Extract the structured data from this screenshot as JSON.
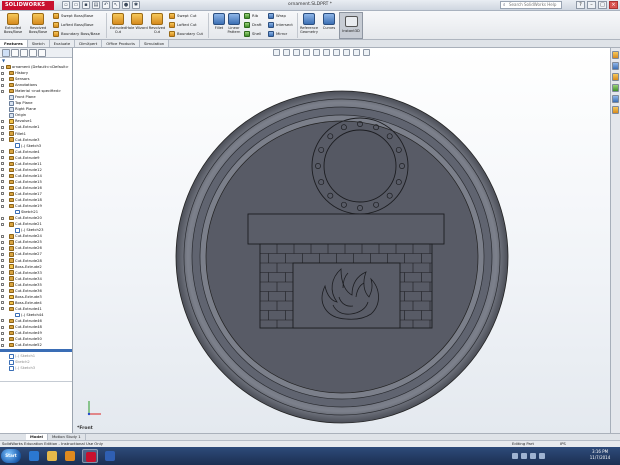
{
  "app": {
    "logo": "SOLIDWORKS",
    "document_title": "ornament.SLDPRT *",
    "search_placeholder": "Search SolidWorks Help"
  },
  "ribbon": {
    "extruded_boss": "Extruded Boss/Base",
    "revolved_boss": "Revolved Boss/Base",
    "swept_boss": "Swept Boss/Base",
    "lofted_boss": "Lofted Boss/Base",
    "boundary_boss": "Boundary Boss/Base",
    "extruded_cut": "Extruded Cut",
    "hole_wizard": "Hole Wizard",
    "revolved_cut": "Revolved Cut",
    "swept_cut": "Swept Cut",
    "lofted_cut": "Lofted Cut",
    "boundary_cut": "Boundary Cut",
    "fillet": "Fillet",
    "linear_pattern": "Linear Pattern",
    "rib": "Rib",
    "draft": "Draft",
    "shell": "Shell",
    "wrap": "Wrap",
    "intersect": "Intersect",
    "mirror": "Mirror",
    "reference_geometry": "Reference Geometry",
    "curves": "Curves",
    "instant3d": "Instant3D"
  },
  "tabs": [
    "Features",
    "Sketch",
    "Evaluate",
    "DimXpert",
    "Office Products",
    "Simulation"
  ],
  "feature_tree": {
    "filter_icon": "funnel-icon",
    "items": [
      {
        "label": "ornament  (Default<<Default>",
        "indent": 1,
        "kind": "part"
      },
      {
        "label": "History",
        "indent": 2,
        "kind": "folder"
      },
      {
        "label": "Sensors",
        "indent": 2,
        "kind": "folder"
      },
      {
        "label": "Annotations",
        "indent": 2,
        "kind": "folder"
      },
      {
        "label": "Material <not specified>",
        "indent": 2,
        "kind": "folder"
      },
      {
        "label": "Front Plane",
        "indent": 2,
        "kind": "plane"
      },
      {
        "label": "Top Plane",
        "indent": 2,
        "kind": "plane"
      },
      {
        "label": "Right Plane",
        "indent": 2,
        "kind": "plane"
      },
      {
        "label": "Origin",
        "indent": 2,
        "kind": "plane"
      },
      {
        "label": "Revolve1",
        "indent": 2,
        "kind": "boss"
      },
      {
        "label": "Cut-Extrude1",
        "indent": 2,
        "kind": "cut"
      },
      {
        "label": "Fillet1",
        "indent": 2,
        "kind": "cut"
      },
      {
        "label": "Cut-Extrude3",
        "indent": 2,
        "kind": "cut"
      },
      {
        "label": "(-) Sketch3",
        "indent": 4,
        "kind": "sketch"
      },
      {
        "label": "Cut-Extrude4",
        "indent": 2,
        "kind": "cut"
      },
      {
        "label": "Cut-Extrude9",
        "indent": 2,
        "kind": "cut"
      },
      {
        "label": "Cut-Extrude11",
        "indent": 2,
        "kind": "cut"
      },
      {
        "label": "Cut-Extrude12",
        "indent": 2,
        "kind": "cut"
      },
      {
        "label": "Cut-Extrude14",
        "indent": 2,
        "kind": "cut"
      },
      {
        "label": "Cut-Extrude15",
        "indent": 2,
        "kind": "cut"
      },
      {
        "label": "Cut-Extrude16",
        "indent": 2,
        "kind": "cut"
      },
      {
        "label": "Cut-Extrude17",
        "indent": 2,
        "kind": "cut"
      },
      {
        "label": "Cut-Extrude18",
        "indent": 2,
        "kind": "cut"
      },
      {
        "label": "Cut-Extrude19",
        "indent": 2,
        "kind": "cut"
      },
      {
        "label": "Sketch21",
        "indent": 4,
        "kind": "sketch"
      },
      {
        "label": "Cut-Extrude20",
        "indent": 2,
        "kind": "cut"
      },
      {
        "label": "Cut-Extrude21",
        "indent": 2,
        "kind": "cut"
      },
      {
        "label": "(-) Sketch23",
        "indent": 4,
        "kind": "sketch"
      },
      {
        "label": "Cut-Extrude24",
        "indent": 2,
        "kind": "cut"
      },
      {
        "label": "Cut-Extrude25",
        "indent": 2,
        "kind": "cut"
      },
      {
        "label": "Cut-Extrude26",
        "indent": 2,
        "kind": "cut"
      },
      {
        "label": "Cut-Extrude27",
        "indent": 2,
        "kind": "cut"
      },
      {
        "label": "Cut-Extrude28",
        "indent": 2,
        "kind": "cut"
      },
      {
        "label": "Boss-Extrude2",
        "indent": 2,
        "kind": "boss"
      },
      {
        "label": "Cut-Extrude33",
        "indent": 2,
        "kind": "cut"
      },
      {
        "label": "Cut-Extrude34",
        "indent": 2,
        "kind": "cut"
      },
      {
        "label": "Cut-Extrude35",
        "indent": 2,
        "kind": "cut"
      },
      {
        "label": "Cut-Extrude36",
        "indent": 2,
        "kind": "cut"
      },
      {
        "label": "Boss-Extrude3",
        "indent": 2,
        "kind": "boss"
      },
      {
        "label": "Boss-Extrude4",
        "indent": 2,
        "kind": "boss"
      },
      {
        "label": "Cut-Extrude41",
        "indent": 2,
        "kind": "cut"
      },
      {
        "label": "(-) Sketch44",
        "indent": 4,
        "kind": "sketch"
      },
      {
        "label": "Cut-Extrude46",
        "indent": 2,
        "kind": "cut"
      },
      {
        "label": "Cut-Extrude48",
        "indent": 2,
        "kind": "cut"
      },
      {
        "label": "Cut-Extrude49",
        "indent": 2,
        "kind": "cut"
      },
      {
        "label": "Cut-Extrude50",
        "indent": 2,
        "kind": "cut"
      },
      {
        "label": "Cut-Extrude52",
        "indent": 2,
        "kind": "cut"
      }
    ],
    "after_rollback": [
      {
        "label": "(-) Sketch1",
        "indent": 2,
        "kind": "sketch"
      },
      {
        "label": "Sketch2",
        "indent": 2,
        "kind": "sketch"
      },
      {
        "label": "(-) Sketch3",
        "indent": 2,
        "kind": "sketch"
      }
    ]
  },
  "viewport": {
    "view_label": "*Front"
  },
  "model_tabs": [
    "Model",
    "Motion Study 1"
  ],
  "status": {
    "left": "SolidWorks Education Edition - Instructional Use Only",
    "mode": "Editing Part",
    "units": "IPS"
  },
  "taskbar": {
    "start": "Start",
    "time": "3:16 PM",
    "date": "11/7/2014"
  },
  "colors": {
    "model_face": "#585b66",
    "model_rim": "#6c707b",
    "brand_red": "#c8102e"
  }
}
